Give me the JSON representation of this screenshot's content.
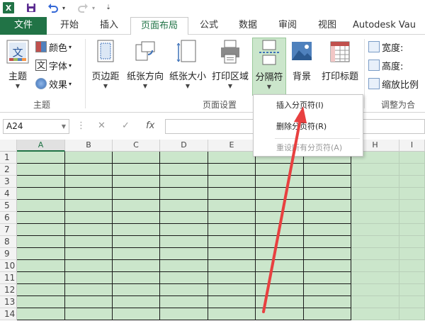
{
  "quick_access": {
    "icons": [
      "excel-logo-icon",
      "save-icon",
      "undo-icon",
      "undo-dropdown-icon",
      "redo-icon",
      "redo-dropdown-icon",
      "customize-qat-icon"
    ]
  },
  "tabs": [
    {
      "label": "文件",
      "state": "file"
    },
    {
      "label": "开始"
    },
    {
      "label": "插入"
    },
    {
      "label": "页面布局",
      "state": "active"
    },
    {
      "label": "公式"
    },
    {
      "label": "数据"
    },
    {
      "label": "审阅"
    },
    {
      "label": "视图"
    },
    {
      "label": "Autodesk Vau"
    }
  ],
  "ribbon": {
    "theme_group": {
      "label": "主题",
      "themes_button": "主题",
      "colors": "颜色",
      "fonts": "字体",
      "effects": "效果",
      "text_icon": "文"
    },
    "page_setup_group": {
      "label": "页面设置",
      "buttons": [
        "页边距",
        "纸张方向",
        "纸张大小",
        "打印区域",
        "分隔符",
        "背景",
        "打印标题"
      ]
    },
    "scale_group": {
      "label": "调整为合",
      "width": "宽度:",
      "height": "高度:",
      "scale": "缩放比例"
    }
  },
  "formula_bar": {
    "name_box": "A24",
    "icons": [
      "cancel-icon",
      "enter-icon",
      "fx-icon"
    ]
  },
  "sheet": {
    "columns": [
      "A",
      "B",
      "C",
      "D",
      "E",
      "F",
      "G",
      "H",
      "I"
    ],
    "selected_column": "A",
    "rows": [
      "1",
      "2",
      "3",
      "4",
      "5",
      "6",
      "7",
      "8",
      "9",
      "10",
      "11",
      "12",
      "13",
      "14"
    ]
  },
  "breaks_menu": {
    "items": [
      {
        "label": "插入分页符(I)",
        "enabled": true
      },
      {
        "label": "删除分页符(R)",
        "enabled": true
      },
      {
        "label": "重设所有分页符(A)",
        "enabled": false
      }
    ]
  },
  "colors": {
    "excel_green": "#217346",
    "cell_fill": "#cbe6cb",
    "annotation_arrow": "#e84040"
  }
}
